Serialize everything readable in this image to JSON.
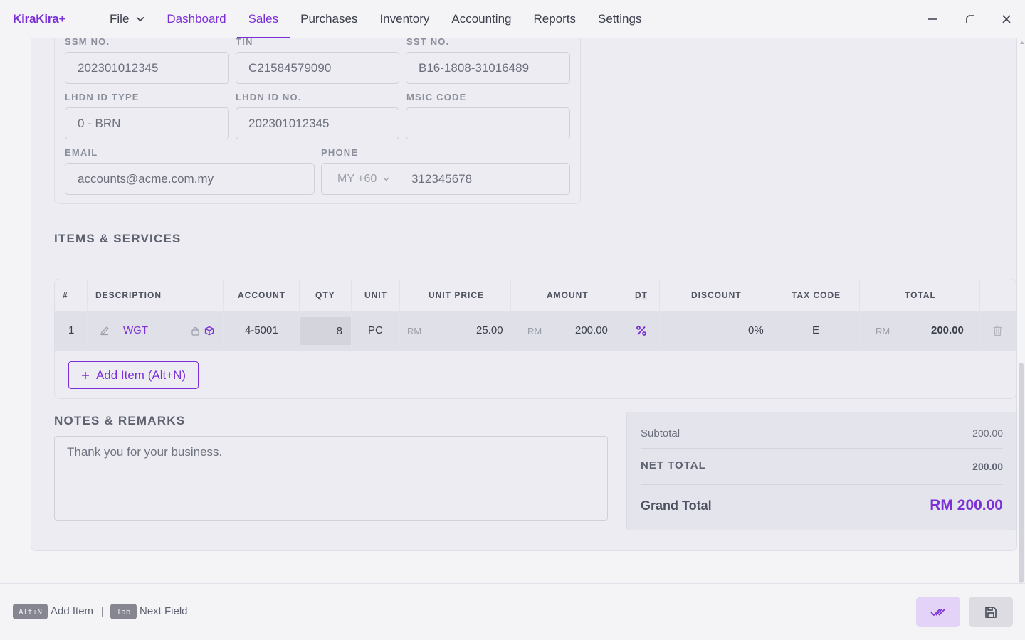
{
  "app": {
    "logo": "KiraKira+"
  },
  "nav": {
    "file": "File",
    "items": [
      "Dashboard",
      "Sales",
      "Purchases",
      "Inventory",
      "Accounting",
      "Reports",
      "Settings"
    ]
  },
  "form": {
    "ssm_label": "SSM NO.",
    "ssm_value": "202301012345",
    "tin_label": "TIN",
    "tin_value": "C21584579090",
    "sst_label": "SST NO.",
    "sst_value": "B16-1808-31016489",
    "lhdn_type_label": "LHDN ID TYPE",
    "lhdn_type_value": "0 - BRN",
    "lhdn_no_label": "LHDN ID NO.",
    "lhdn_no_value": "202301012345",
    "msic_label": "MSIC CODE",
    "msic_value": "",
    "email_label": "EMAIL",
    "email_value": "accounts@acme.com.my",
    "phone_label": "PHONE",
    "phone_country": "MY +60",
    "phone_value": "312345678"
  },
  "items_section": {
    "title": "ITEMS & SERVICES",
    "headers": {
      "no": "#",
      "description": "DESCRIPTION",
      "account": "ACCOUNT",
      "qty": "QTY",
      "unit": "UNIT",
      "unit_price": "UNIT PRICE",
      "amount": "AMOUNT",
      "dt": "DT",
      "discount": "DISCOUNT",
      "tax_code": "TAX CODE",
      "total": "TOTAL"
    },
    "rows": [
      {
        "no": "1",
        "description": "WGT",
        "account": "4-5001",
        "qty": "8",
        "unit": "PC",
        "currency": "RM",
        "unit_price": "25.00",
        "amount": "200.00",
        "discount": "0%",
        "tax_code": "E",
        "total": "200.00"
      }
    ],
    "add_button": "Add Item (Alt+N)"
  },
  "notes": {
    "title": "NOTES & REMARKS",
    "value": "Thank you for your business."
  },
  "summary": {
    "subtotal_label": "Subtotal",
    "subtotal_value": "200.00",
    "net_total_label": "NET TOTAL",
    "net_total_value": "200.00",
    "grand_total_label": "Grand Total",
    "grand_total_value": "RM 200.00"
  },
  "footer": {
    "shortcut1_key": "Alt+N",
    "shortcut1_label": "Add Item",
    "separator": "|",
    "shortcut2_key": "Tab",
    "shortcut2_label": "Next Field"
  },
  "colors": {
    "accent": "#7b2fd6",
    "background": "#f4f4f7",
    "card": "#ececf2"
  }
}
